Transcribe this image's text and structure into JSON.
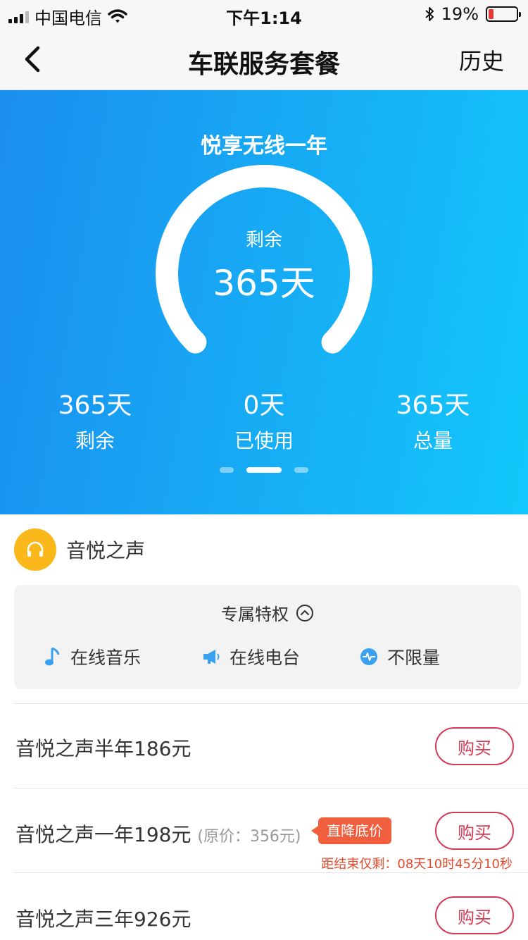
{
  "status_bar": {
    "carrier": "中国电信",
    "time": "下午1:14",
    "battery": "19%",
    "battery_level": 0.19
  },
  "nav": {
    "title": "车联服务套餐",
    "history": "历史"
  },
  "hero": {
    "plan_name": "悦享无线一年",
    "gauge_label": "剩余",
    "gauge_value": "365天",
    "gauge_fraction": 1.0,
    "stats": [
      {
        "value": "365天",
        "label": "剩余"
      },
      {
        "value": "0天",
        "label": "已使用"
      },
      {
        "value": "365天",
        "label": "总量"
      }
    ],
    "pages": 3,
    "active_page": 1
  },
  "service": {
    "name": "音悦之声",
    "icon": "headphones-icon",
    "privilege_title": "专属特权",
    "privileges": [
      {
        "label": "在线音乐",
        "icon": "music-note-icon"
      },
      {
        "label": "在线电台",
        "icon": "megaphone-icon"
      },
      {
        "label": "不限量",
        "icon": "pulse-icon"
      }
    ]
  },
  "packages": [
    {
      "text": "音悦之声半年186元",
      "buy": "购买"
    },
    {
      "text": "音悦之声一年198元",
      "original": "(原价：356元)",
      "badge": "直降底价",
      "countdown": "距结束仅剩：08天10时45分10秒",
      "buy": "购买"
    },
    {
      "text": "音悦之声三年926元",
      "buy": "购买"
    }
  ],
  "colors": {
    "accent_blue": "#1a8ef0",
    "buy_red": "#d23a55",
    "badge_orange": "#f25f3f",
    "service_yellow": "#fbb81b"
  }
}
